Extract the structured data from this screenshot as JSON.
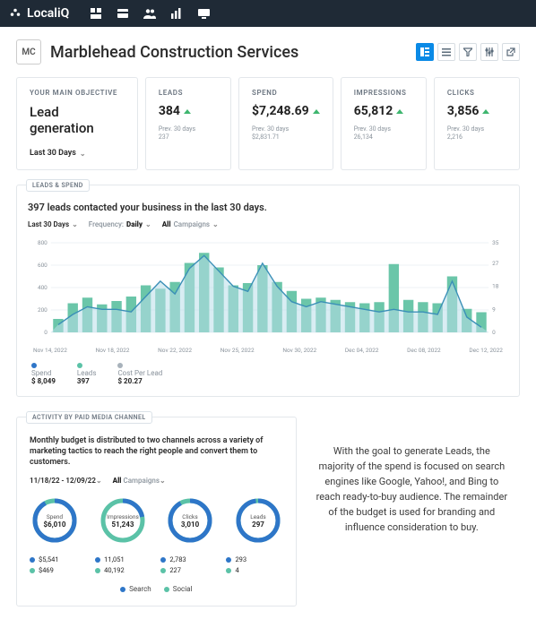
{
  "brand": "LocaliQ",
  "company": {
    "initials": "MC",
    "name": "Marblehead Construction Services"
  },
  "objective": {
    "label": "YOUR MAIN OBJECTIVE",
    "value": "Lead generation",
    "period": "Last 30 Days"
  },
  "kpis": {
    "leads": {
      "label": "LEADS",
      "value": "384",
      "prev_label": "Prev. 30 days",
      "prev": "237"
    },
    "spend": {
      "label": "SPEND",
      "value": "$7,248.69",
      "prev_label": "Prev. 30 days",
      "prev": "$2,831.71"
    },
    "impressions": {
      "label": "IMPRESSIONS",
      "value": "65,812",
      "prev_label": "Prev. 30 days",
      "prev": "26,134"
    },
    "clicks": {
      "label": "CLICKS",
      "value": "3,856",
      "prev_label": "Prev. 30 days",
      "prev": "2,216"
    }
  },
  "leads_spend": {
    "pill": "LEADS & SPEND",
    "headline": "397 leads contacted your business in the last 30 days.",
    "filters": {
      "period": "Last 30 Days",
      "freq_label": "Frequency:",
      "freq": "Daily",
      "camp_label": "All",
      "camp": "Campaigns"
    },
    "legend": {
      "spend": {
        "label": "Spend",
        "value": "$ 8,049"
      },
      "leads": {
        "label": "Leads",
        "value": "397"
      },
      "cpl": {
        "label": "Cost Per Lead",
        "value": "$ 20.27"
      }
    }
  },
  "activity": {
    "pill": "ACTIVITY BY PAID MEDIA CHANNEL",
    "desc": "Monthly budget is distributed to two channels across a variety of marketing tactics to reach the right people and convert them to customers.",
    "filters": {
      "dates": "11/18/22 - 12/09/22",
      "camp_label": "All",
      "camp": "Campaigns"
    },
    "donuts": {
      "spend": {
        "label": "Spend",
        "value": "$6,010"
      },
      "impressions": {
        "label": "Impressions",
        "value": "51,243"
      },
      "clicks": {
        "label": "Clicks",
        "value": "3,010"
      },
      "leads": {
        "label": "Leads",
        "value": "297"
      }
    },
    "breakdown": {
      "spend": {
        "search": "$5,541",
        "social": "$469"
      },
      "impressions": {
        "search": "11,051",
        "social": "40,192"
      },
      "clicks": {
        "search": "2,783",
        "social": "227"
      },
      "leads": {
        "search": "293",
        "social": "4"
      }
    },
    "channel_legend": {
      "search": "Search",
      "social": "Social"
    }
  },
  "narrative": "With the goal to generate Leads, the majority of the spend is focused on search engines like Google, Yahoo!, and Bing to reach ready-to-buy audience. The remainder of the budget is used for branding and influence consideration to buy.",
  "chart_data": {
    "type": "bar+line",
    "title": "Leads & Spend — last 30 days",
    "x_ticks": [
      "Nov 14, 2022",
      "Nov 18, 2022",
      "Nov 22, 2022",
      "Nov 25, 2022",
      "Nov 30, 2022",
      "Dec 04, 2022",
      "Dec 08, 2022",
      "Dec 12, 2022"
    ],
    "y_left": {
      "label": "Spend ($)",
      "ticks": [
        0,
        200,
        400,
        600,
        800
      ]
    },
    "y_right": {
      "label": "Leads",
      "ticks": [
        0,
        9,
        18,
        27,
        35
      ]
    },
    "series": [
      {
        "name": "Spend",
        "axis": "left",
        "type": "bar",
        "values": [
          120,
          260,
          310,
          250,
          280,
          320,
          420,
          390,
          450,
          620,
          710,
          580,
          420,
          440,
          600,
          450,
          370,
          300,
          310,
          290,
          270,
          260,
          270,
          610,
          290,
          270,
          260,
          500,
          210,
          180
        ]
      },
      {
        "name": "Leads",
        "axis": "right",
        "type": "line",
        "values": [
          3,
          7,
          10,
          9,
          9,
          8,
          14,
          20,
          15,
          25,
          30,
          24,
          18,
          16,
          27,
          18,
          12,
          10,
          12,
          11,
          10,
          9,
          8,
          9,
          8,
          8,
          7,
          20,
          6,
          2
        ]
      }
    ]
  }
}
